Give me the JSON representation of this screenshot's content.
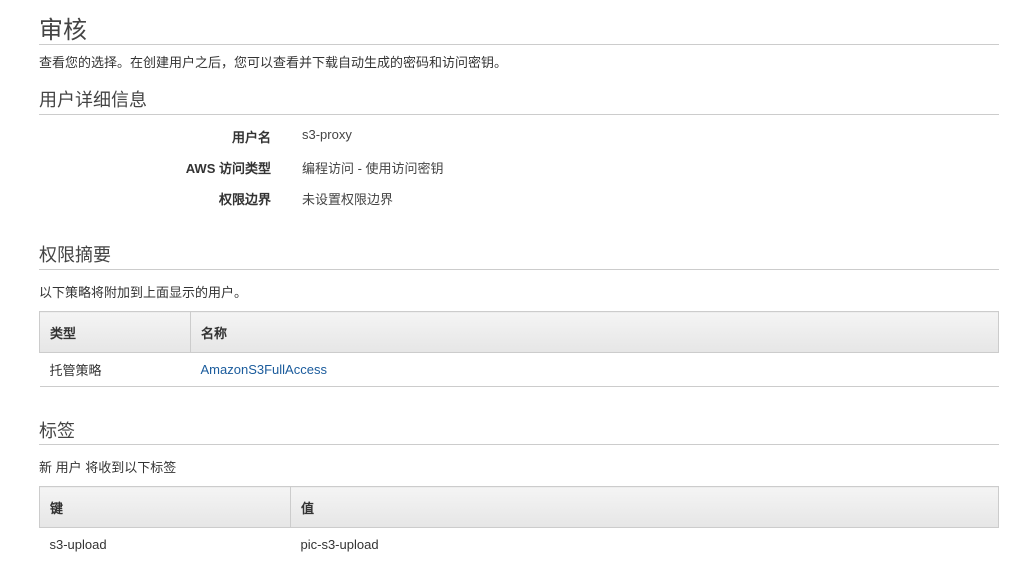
{
  "review": {
    "title": "审核",
    "description": "查看您的选择。在创建用户之后，您可以查看并下载自动生成的密码和访问密钥。"
  },
  "user_details": {
    "title": "用户详细信息",
    "rows": [
      {
        "label": "用户名",
        "value": "s3-proxy"
      },
      {
        "label": "AWS 访问类型",
        "value": "编程访问 - 使用访问密钥"
      },
      {
        "label": "权限边界",
        "value": "未设置权限边界"
      }
    ]
  },
  "permissions": {
    "title": "权限摘要",
    "description": "以下策略将附加到上面显示的用户。",
    "headers": [
      "类型",
      "名称"
    ],
    "rows": [
      {
        "type": "托管策略",
        "name": "AmazonS3FullAccess"
      }
    ]
  },
  "tags": {
    "title": "标签",
    "description": "新 用户 将收到以下标签",
    "headers": [
      "键",
      "值"
    ],
    "rows": [
      {
        "key": "s3-upload",
        "value": "pic-s3-upload"
      }
    ]
  }
}
